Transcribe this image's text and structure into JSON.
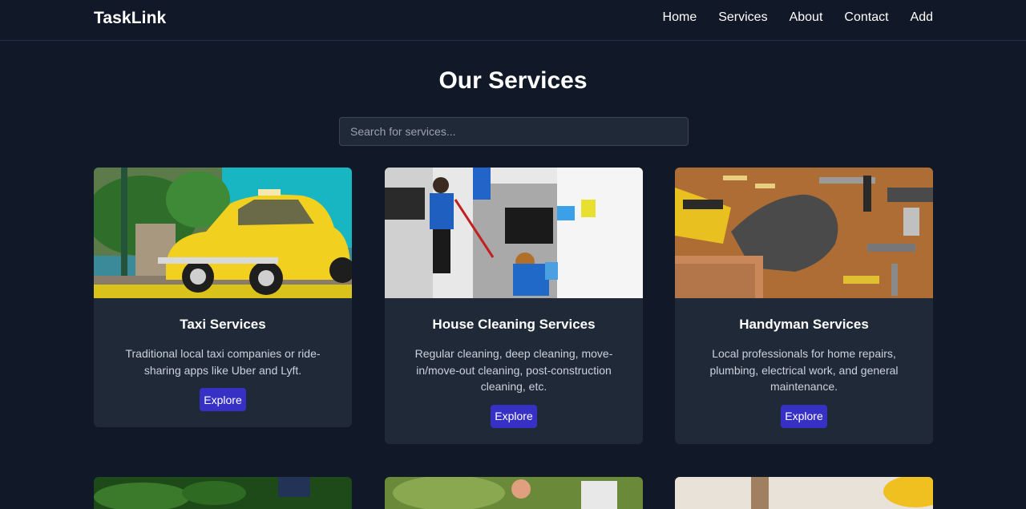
{
  "nav": {
    "brand": "TaskLink",
    "links": [
      "Home",
      "Services",
      "About",
      "Contact",
      "Add"
    ]
  },
  "main": {
    "title": "Our Services",
    "search_placeholder": "Search for services..."
  },
  "cards": [
    {
      "title": "Taxi Services",
      "desc": "Traditional local taxi companies or ride-sharing apps like Uber and Lyft.",
      "button": "Explore"
    },
    {
      "title": "House Cleaning Services",
      "desc": "Regular cleaning, deep cleaning, move-in/move-out cleaning, post-construction cleaning, etc.",
      "button": "Explore"
    },
    {
      "title": "Handyman Services",
      "desc": "Local professionals for home repairs, plumbing, electrical work, and general maintenance.",
      "button": "Explore"
    }
  ],
  "colors": {
    "background": "#111827",
    "card": "#1f2937",
    "button": "#3730c4"
  }
}
